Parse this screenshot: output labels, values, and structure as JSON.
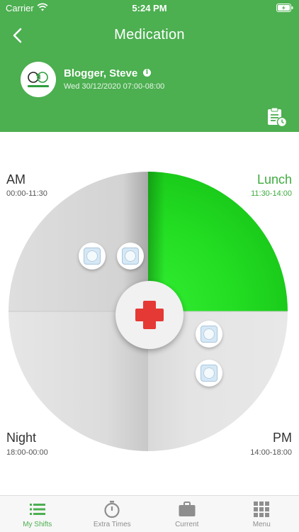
{
  "status_bar": {
    "carrier": "Carrier",
    "time": "5:24 PM"
  },
  "header": {
    "title": "Medication",
    "client_name": "Blogger, Steve",
    "shift_datetime": "Wed 30/12/2020 07:00-08:00"
  },
  "wheel": {
    "quadrants": [
      {
        "label": "AM",
        "time": "00:00-11:30"
      },
      {
        "label": "Lunch",
        "time": "11:30-14:00",
        "active": true
      },
      {
        "label": "Night",
        "time": "18:00-00:00"
      },
      {
        "label": "PM",
        "time": "14:00-18:00"
      }
    ],
    "active_color": "#22dd22"
  },
  "tabs": [
    {
      "label": "My Shifts",
      "icon": "list-icon",
      "active": true
    },
    {
      "label": "Extra Times",
      "icon": "stopwatch-icon"
    },
    {
      "label": "Current",
      "icon": "briefcase-icon"
    },
    {
      "label": "Menu",
      "icon": "grid-icon"
    }
  ],
  "colors": {
    "brand": "#4caf50",
    "cross": "#e53935"
  }
}
